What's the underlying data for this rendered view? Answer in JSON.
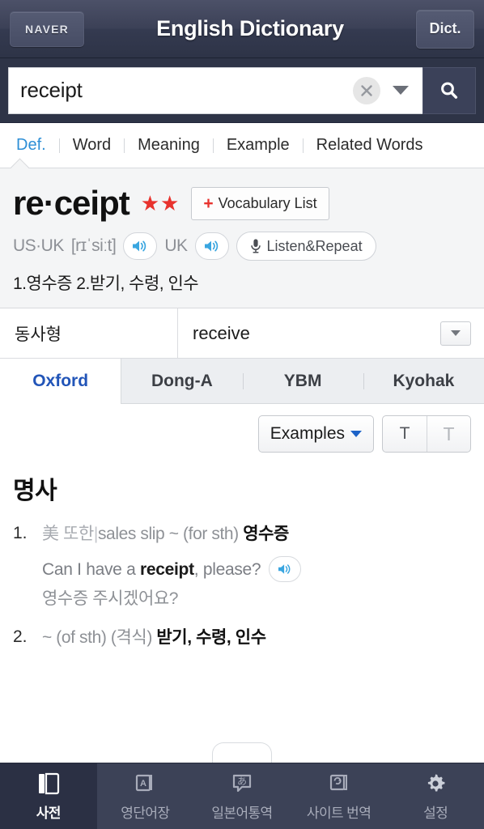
{
  "header": {
    "brand_label": "NAVER",
    "title": "English Dictionary",
    "mode_button_label": "Dict."
  },
  "search": {
    "value": "receipt",
    "placeholder": "receipt",
    "clear_icon": "close-x-icon",
    "history_icon": "chevron-down-icon",
    "submit_icon": "search-icon"
  },
  "sub_nav": {
    "items": [
      {
        "label": "Def.",
        "active": true
      },
      {
        "label": "Word",
        "active": false
      },
      {
        "label": "Meaning",
        "active": false
      },
      {
        "label": "Example",
        "active": false
      },
      {
        "label": "Related Words",
        "active": false
      }
    ]
  },
  "entry": {
    "headword": "re·ceipt",
    "stars": "★★",
    "star_count": 2,
    "vocabulary_button": {
      "plus": "+",
      "label": "Vocabulary List"
    },
    "pronunciation": {
      "us_uk_label": "US·UK",
      "phonetic": "[rɪˈsiːt]",
      "uk_label": "UK",
      "speaker_icon": "speaker-icon",
      "listen_repeat": {
        "icon": "microphone-icon",
        "label": "Listen&Repeat"
      }
    },
    "short_definitions": "1.영수증 2.받기, 수령, 인수"
  },
  "verb_form": {
    "label": "동사형",
    "value": "receive",
    "toggle_icon": "chevron-down-icon"
  },
  "source_tabs": [
    {
      "label": "Oxford",
      "active": true
    },
    {
      "label": "Dong-A",
      "active": false
    },
    {
      "label": "YBM",
      "active": false
    },
    {
      "label": "Kyohak",
      "active": false
    }
  ],
  "controls": {
    "examples_button": {
      "label": "Examples",
      "icon": "chevron-down-icon"
    },
    "text_size_small": "T",
    "text_size_large": "T"
  },
  "definition": {
    "part_of_speech": "명사",
    "senses": [
      {
        "number": "1.",
        "usage_prefix": "美 또한",
        "divider": "|",
        "gloss_en": "sales slip ~ (for sth)",
        "gloss_ko": "영수증",
        "example": {
          "en_before": "Can I have a ",
          "en_bold": "receipt",
          "en_after": ", please?",
          "speaker_icon": "speaker-icon",
          "ko": "영수증 주시겠어요?"
        }
      },
      {
        "number": "2.",
        "usage_prefix": "",
        "divider": "",
        "gloss_en": "~ (of sth) (격식)",
        "gloss_ko": "받기, 수령, 인수",
        "example": null
      }
    ]
  },
  "bottom_nav": [
    {
      "label": "사전",
      "icon": "book-icon",
      "active": true
    },
    {
      "label": "영단어장",
      "icon": "flashcard-a-icon",
      "active": false
    },
    {
      "label": "일본어통역",
      "icon": "japanese-speech-bubble-icon",
      "active": false
    },
    {
      "label": "사이트 번역",
      "icon": "translate-pages-icon",
      "active": false
    },
    {
      "label": "설정",
      "icon": "gear-icon",
      "active": false
    }
  ],
  "colors": {
    "header_bg": "#3c4157",
    "search_bg": "#2e3447",
    "accent_blue": "#2e8fd6",
    "tab_active_blue": "#2255b8",
    "star_red": "#e8322d",
    "nav_bg": "#3c4257",
    "nav_active_bg": "#2b3044"
  }
}
